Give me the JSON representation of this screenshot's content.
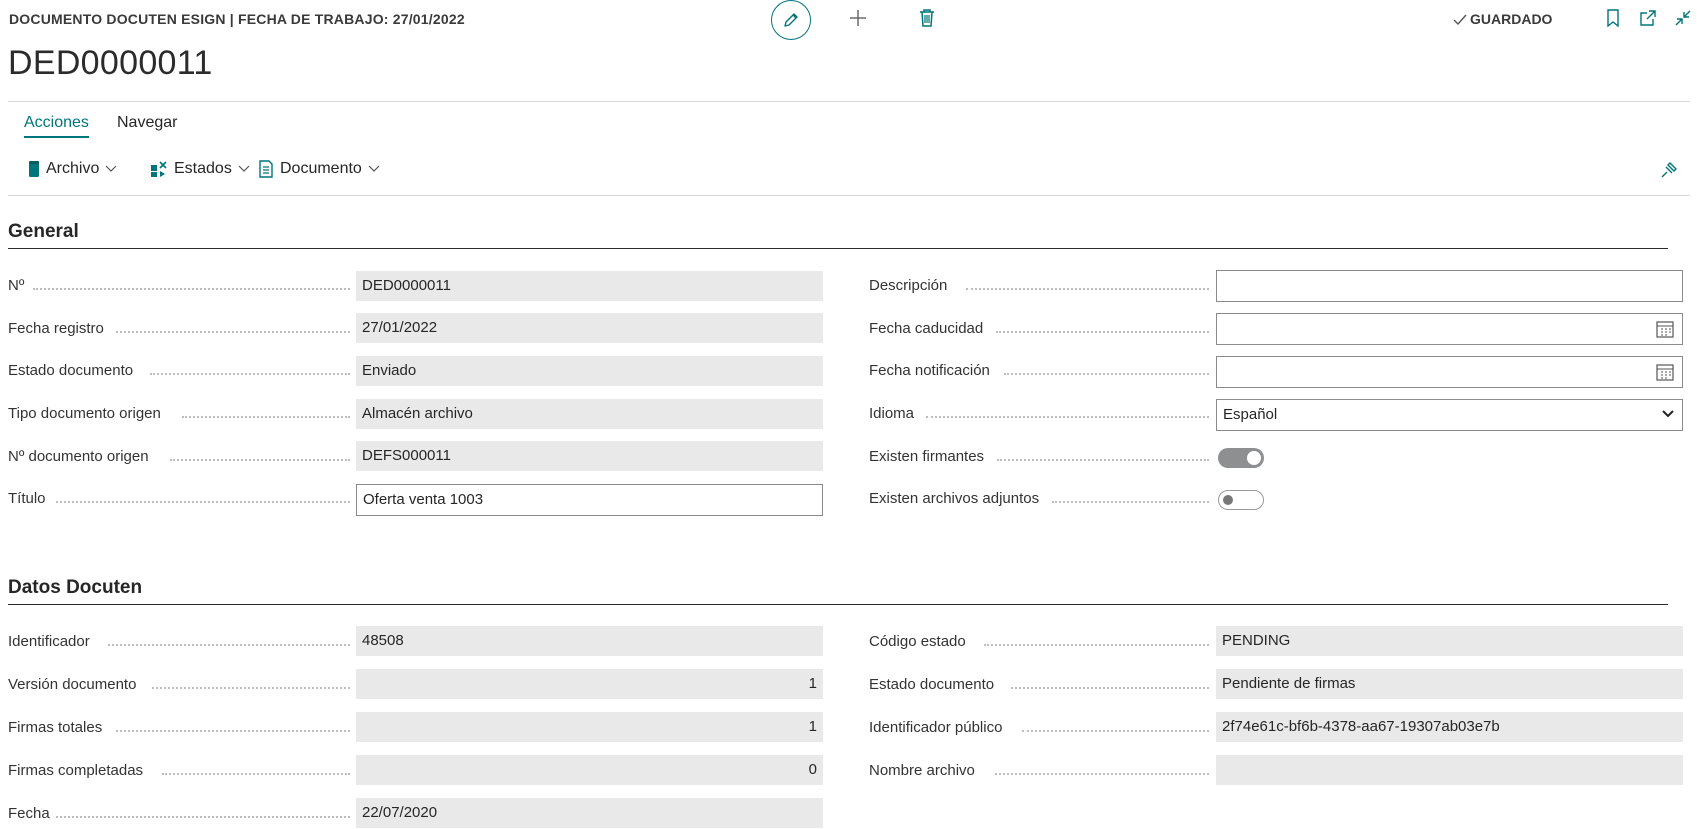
{
  "header": {
    "caption": "DOCUMENTO DOCUTEN ESIGN | FECHA DE TRABAJO: 27/01/2022",
    "saved_status": "GUARDADO",
    "record_title": "DED0000011"
  },
  "tabs": [
    {
      "label": "Acciones",
      "active": true
    },
    {
      "label": "Navegar",
      "active": false
    }
  ],
  "actions": [
    {
      "label": "Archivo",
      "icon": "archive-icon"
    },
    {
      "label": "Estados",
      "icon": "states-icon"
    },
    {
      "label": "Documento",
      "icon": "document-icon"
    }
  ],
  "sections": {
    "general": {
      "title": "General",
      "left": [
        {
          "label": "Nº",
          "value": "DED0000011"
        },
        {
          "label": "Fecha registro",
          "value": "27/01/2022"
        },
        {
          "label": "Estado documento",
          "value": "Enviado"
        },
        {
          "label": "Tipo documento origen",
          "value": "Almacén archivo"
        },
        {
          "label": "Nº documento origen",
          "value": "DEFS000011"
        },
        {
          "label": "Título",
          "value": "Oferta venta 1003"
        }
      ],
      "right": [
        {
          "label": "Descripción",
          "value": ""
        },
        {
          "label": "Fecha caducidad",
          "value": ""
        },
        {
          "label": "Fecha notificación",
          "value": ""
        },
        {
          "label": "Idioma",
          "value": "Español"
        },
        {
          "label": "Existen firmantes",
          "value": true
        },
        {
          "label": "Existen archivos adjuntos",
          "value": false
        }
      ]
    },
    "docuten": {
      "title": "Datos Docuten",
      "left": [
        {
          "label": "Identificador",
          "value": "48508"
        },
        {
          "label": "Versión documento",
          "value": "1"
        },
        {
          "label": "Firmas totales",
          "value": "1"
        },
        {
          "label": "Firmas completadas",
          "value": "0"
        },
        {
          "label": "Fecha",
          "value": "22/07/2020"
        }
      ],
      "right": [
        {
          "label": "Código estado",
          "value": "PENDING"
        },
        {
          "label": "Estado documento",
          "value": "Pendiente de firmas"
        },
        {
          "label": "Identificador público",
          "value": "2f74e61c-bf6b-4378-aa67-19307ab03e7b"
        },
        {
          "label": "Nombre archivo",
          "value": ""
        }
      ]
    }
  },
  "colors": {
    "accent": "#00757a",
    "readonly_bg": "#e9e9ea"
  }
}
